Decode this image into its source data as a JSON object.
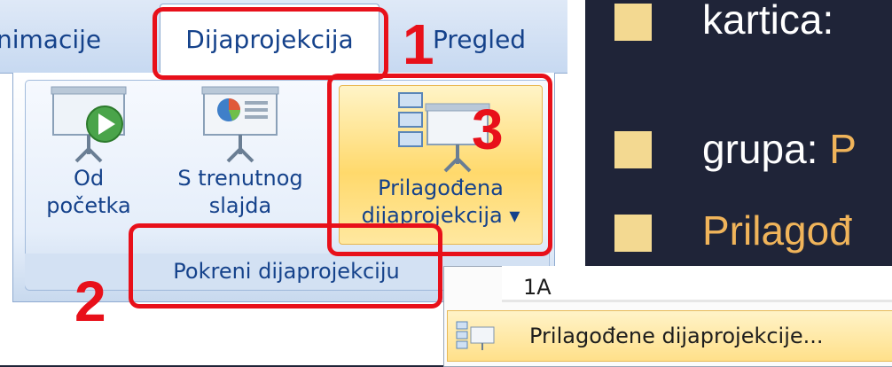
{
  "ribbon": {
    "tabs": {
      "animations": "nimacije",
      "slideshow": "Dijaprojekcija",
      "review": "Pregled"
    },
    "buttons": {
      "from_start": [
        "Od",
        "početka"
      ],
      "from_current": [
        "S trenutnog",
        "slajda"
      ],
      "custom_show": [
        "Prilagođena",
        "dijaprojekcija ▾"
      ]
    },
    "group_label": "Pokreni dijaprojekciju"
  },
  "annotations": {
    "marker_1": "1",
    "marker_2": "2",
    "marker_3": "3",
    "highlight_color": "#e8101a"
  },
  "dropdown": {
    "item_1": "1A",
    "item_2": "Prilagođene dijaprojekcije..."
  },
  "slide": {
    "bullets": [
      "kartica:",
      "grupa: P",
      "Prilagođ"
    ],
    "bullet_color": "#f3d991",
    "accent_color": "#f0b45a",
    "background": "#1f2438"
  }
}
